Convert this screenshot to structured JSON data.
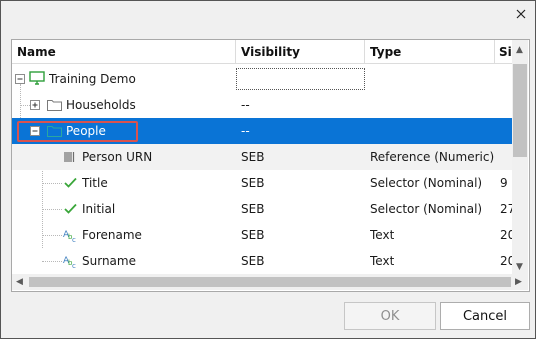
{
  "columns": {
    "name": "Name",
    "visibility": "Visibility",
    "type": "Type",
    "size": "Si"
  },
  "rows": [
    {
      "name": "Training Demo",
      "icon": "computer-icon",
      "visibility": "",
      "type": "",
      "size": ""
    },
    {
      "name": "Households",
      "icon": "folder-icon",
      "visibility": "--",
      "type": "",
      "size": ""
    },
    {
      "name": "People",
      "icon": "folder-icon",
      "visibility": "--",
      "type": "",
      "size": "",
      "selected": true
    },
    {
      "name": "Person URN",
      "icon": "barcode-icon",
      "visibility": "SEB",
      "type": "Reference (Numeric)",
      "size": ""
    },
    {
      "name": "Title",
      "icon": "checkmark-icon",
      "visibility": "SEB",
      "type": "Selector (Nominal)",
      "size": "9"
    },
    {
      "name": "Initial",
      "icon": "checkmark-icon",
      "visibility": "SEB",
      "type": "Selector (Nominal)",
      "size": "27"
    },
    {
      "name": "Forename",
      "icon": "text-abc-icon",
      "visibility": "SEB",
      "type": "Text",
      "size": "20"
    },
    {
      "name": "Surname",
      "icon": "text-abc-icon",
      "visibility": "SEB",
      "type": "Text",
      "size": "20"
    }
  ],
  "buttons": {
    "ok": "OK",
    "cancel": "Cancel"
  },
  "colors": {
    "selection": "#0a74d6",
    "highlight_border": "#d9534f",
    "check": "#3aa63a",
    "computer": "#2e9e3a"
  }
}
